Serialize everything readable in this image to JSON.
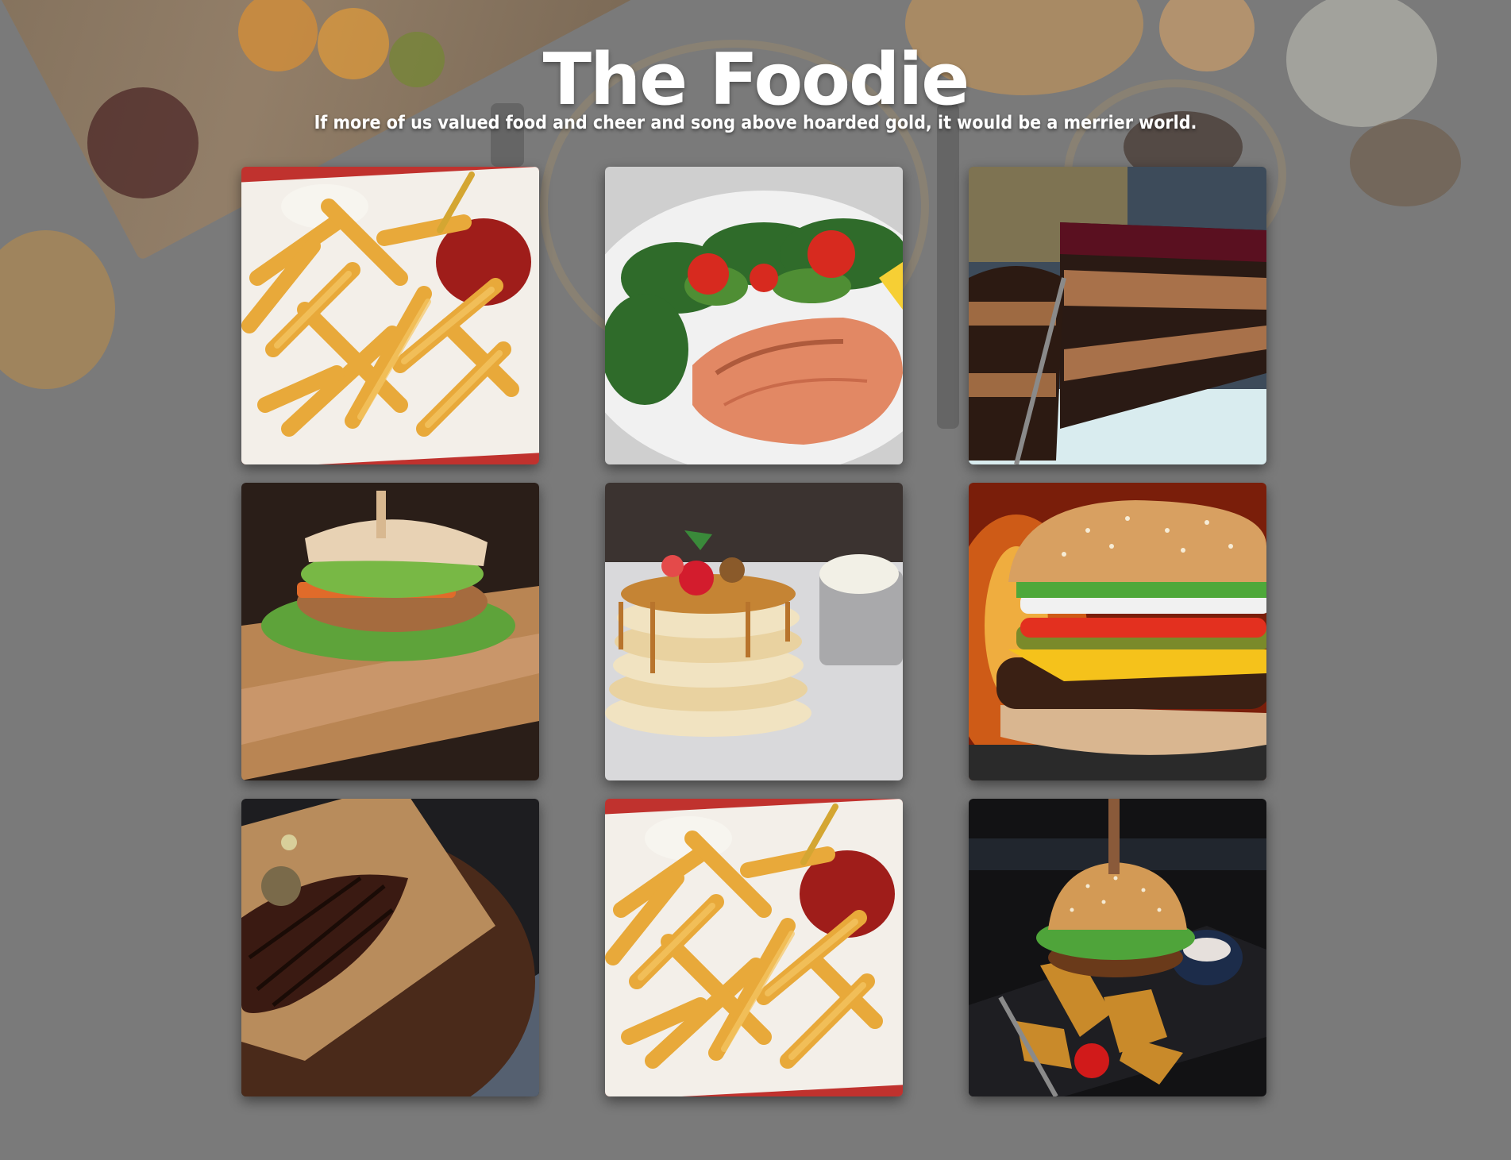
{
  "header": {
    "title": "The Foodie",
    "tagline": "If more of us valued food and cheer and song above hoarded gold, it would be a merrier world."
  },
  "gallery": {
    "items": [
      {
        "dish": "fries"
      },
      {
        "dish": "salmon-salad"
      },
      {
        "dish": "chocolate-cake"
      },
      {
        "dish": "veggie-burger"
      },
      {
        "dish": "pancakes"
      },
      {
        "dish": "cheeseburger"
      },
      {
        "dish": "steak"
      },
      {
        "dish": "fries"
      },
      {
        "dish": "burger-with-wedges"
      }
    ]
  },
  "colors": {
    "background": "#7a7a7a",
    "title": "#ffffff"
  }
}
